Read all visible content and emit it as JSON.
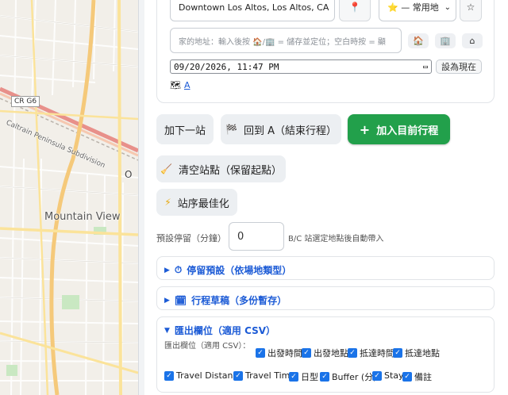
{
  "map": {
    "road_shield": "CR G6",
    "rail_label": "Caltrain Peninsula Subdivision",
    "city_label": "Mountain View",
    "marker_letter": "O"
  },
  "stop_editor": {
    "address_value": "Downtown Los Altos, Los Altos, CA",
    "pin_icon": "pin-icon",
    "favorites_select": "⭐ — 常用地",
    "star_icon": "star-icon",
    "home_placeholder": "家的地址：輸入後按 🏠/🏢 = 儲存並定位；空白時按 = 顯",
    "home_btn": "🏠",
    "office_btn": "🏢",
    "house_btn": "⌂",
    "datetime_value": "09/20/2026, 11:47 PM",
    "set_now_label": "設為現在",
    "stop_link": "A"
  },
  "actions": {
    "add_next": "加下一站",
    "return_a_icon": "🏁",
    "return_a": "回到 A（結束行程）",
    "add_current_icon": "+",
    "add_current": "加入目前行程",
    "clear_icon": "🧹",
    "clear_stops": "清空站點（保留起點）",
    "optimize_icon": "⚡",
    "optimize": "站序最佳化"
  },
  "default_stay": {
    "label": "預設停留（分鐘）",
    "value": "0",
    "hint": "B/C 站選定地點後自動帶入"
  },
  "accordions": {
    "stay_presets": {
      "arrow": "▶",
      "icon": "⏱",
      "title": "停留預設（依場地類型）"
    },
    "drafts": {
      "arrow": "▶",
      "icon": "🗓",
      "title": "行程草稿（多份暫存）"
    },
    "export": {
      "arrow": "▼",
      "title": "匯出欄位（適用 CSV）",
      "sub_label": "匯出欄位（適用 CSV）：",
      "row1": [
        "出發時間",
        "出發地點",
        "抵達時間",
        "抵達地點"
      ],
      "row2": [
        "Travel Distance",
        "Travel Time",
        "日型",
        "Buffer (分)",
        "Stay",
        "備註"
      ]
    }
  },
  "colors": {
    "accent_blue": "#1c5bd6",
    "green": "#22a04b",
    "checkbox": "#1a73e8"
  }
}
